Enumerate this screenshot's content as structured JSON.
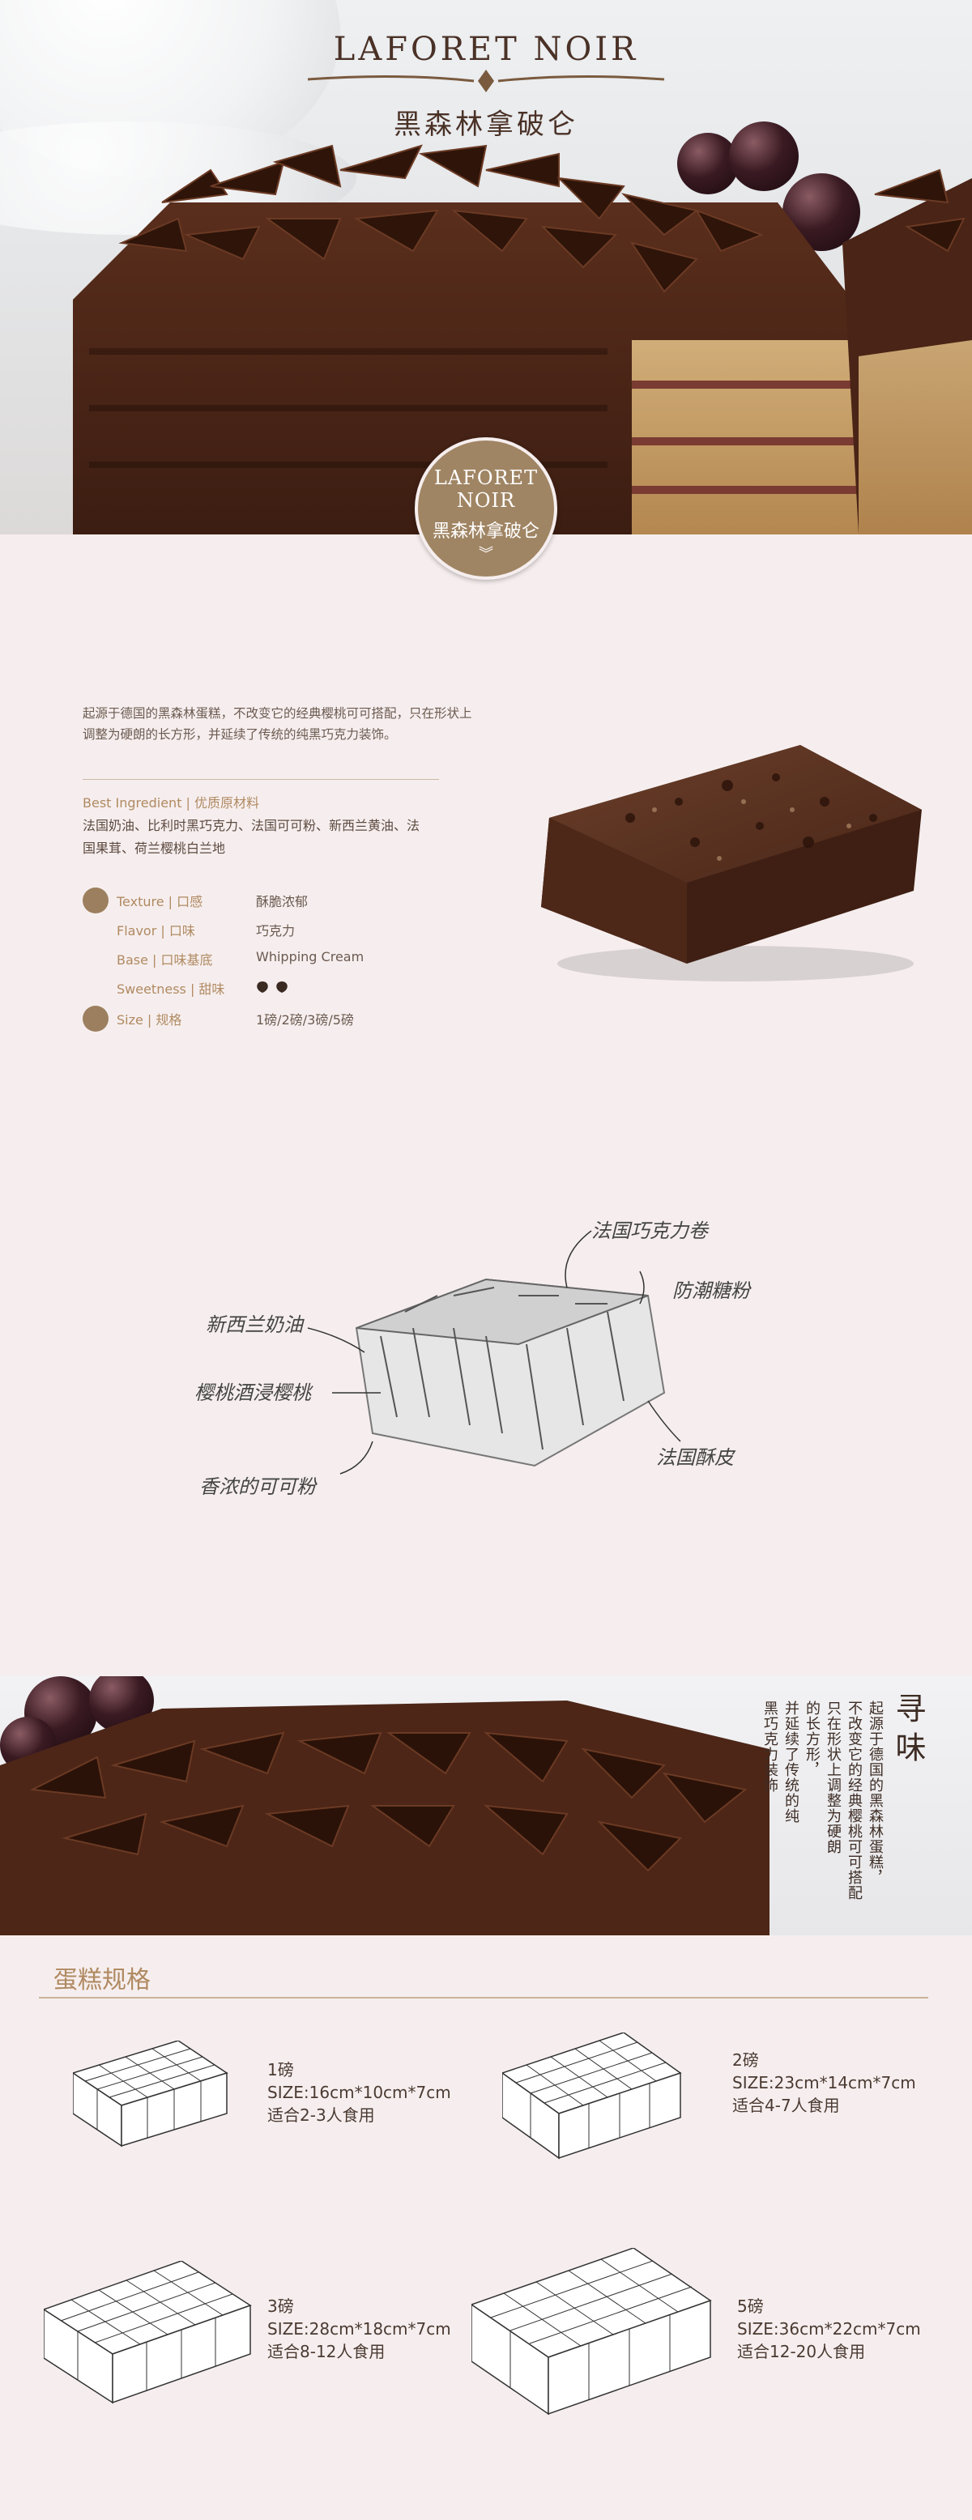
{
  "hero": {
    "title_en": "LAFORET NOIR",
    "title_cn": "黑森林拿破仑"
  },
  "badge": {
    "title_en_line1": "LAFORET",
    "title_en_line2": "NOIR",
    "title_cn": "黑森林拿破仑",
    "arrow_icon": "chevron-down-icon"
  },
  "detail": {
    "description": "起源于德国的黑森林蛋糕，不改变它的经典樱桃可可搭配，只在形状上调整为硬朗的长方形，并延续了传统的纯黑巧克力装饰。",
    "ingredient_title": "Best Ingredient | 优质原材料",
    "ingredient_text": "法国奶油、比利时黑巧克力、法国可可粉、新西兰黄油、法国果茸、荷兰樱桃白兰地",
    "attributes": [
      {
        "key": "Texture | 口感",
        "value": "酥脆浓郁"
      },
      {
        "key": "Flavor | 口味",
        "value": "巧克力"
      },
      {
        "key": "Base | 口味基底",
        "value": "Whipping Cream"
      },
      {
        "key": "Sweetness | 甜味",
        "value": ""
      },
      {
        "key": "Size | 规格",
        "value": "1磅/2磅/3磅/5磅"
      }
    ],
    "sweetness_level": 2,
    "accent_color": "#a08564"
  },
  "sketch": {
    "notes": [
      "法国巧克力卷",
      "防潮糖粉",
      "樱桃酒浸樱桃",
      "法国酥皮",
      "新西兰奶油",
      "香浓的可可粉"
    ]
  },
  "band": {
    "title": "寻味",
    "columns": [
      "起源于德国的黑森林蛋糕，",
      "不改变它的经典樱桃可可搭配",
      "只在形状上调整为硬朗",
      "的长方形，",
      "并延续了传统的纯",
      "黑巧克力装饰"
    ]
  },
  "specs": {
    "heading": "蛋糕规格",
    "items": [
      {
        "weight": "1磅",
        "size": "SIZE:16cm*10cm*7cm",
        "serves": "适合2-3人食用"
      },
      {
        "weight": "2磅",
        "size": "SIZE:23cm*14cm*7cm",
        "serves": "适合4-7人食用"
      },
      {
        "weight": "3磅",
        "size": "SIZE:28cm*18cm*7cm",
        "serves": "适合8-12人食用"
      },
      {
        "weight": "5磅",
        "size": "SIZE:36cm*22cm*7cm",
        "serves": "适合12-20人食用"
      }
    ]
  }
}
